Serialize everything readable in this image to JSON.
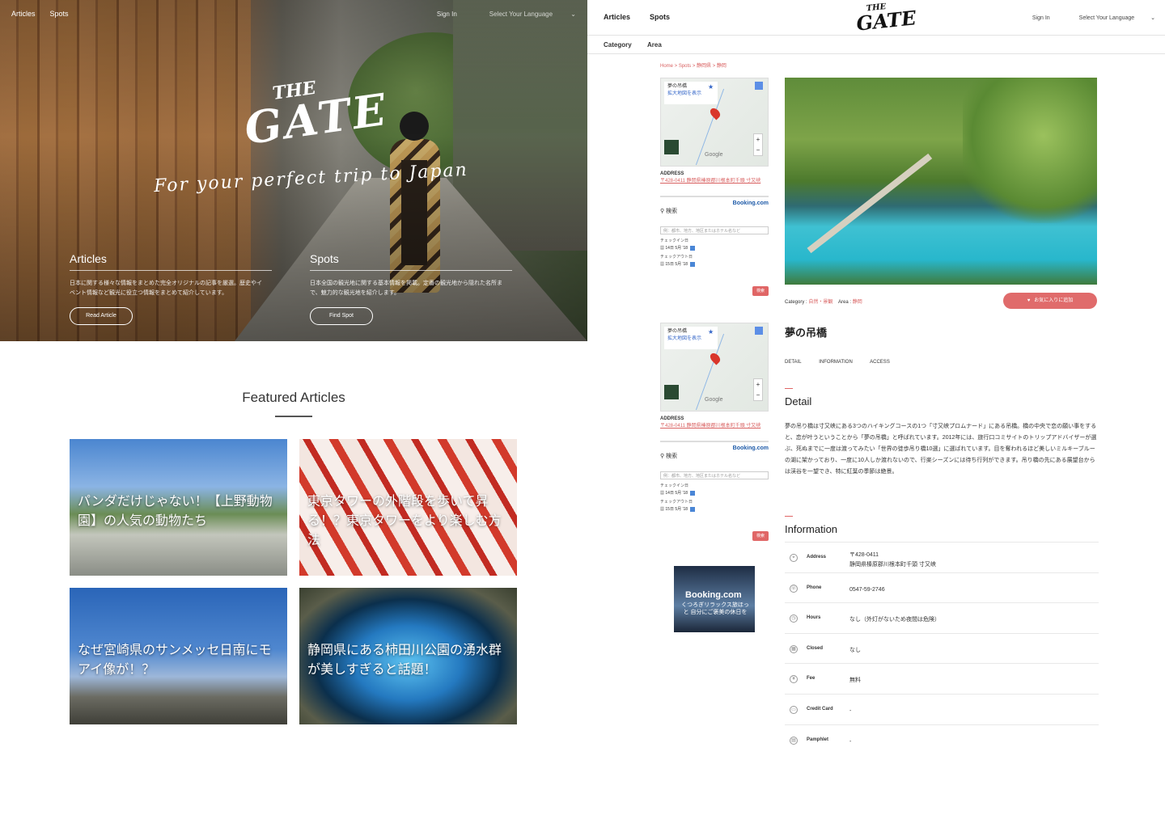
{
  "home": {
    "nav": {
      "articles": "Articles",
      "spots": "Spots",
      "sign_in": "Sign In",
      "language": "Select Your Language"
    },
    "logo": {
      "the": "THE",
      "gate": "GATE"
    },
    "tagline": "For your perfect trip to Japan",
    "articles_col": {
      "title": "Articles",
      "text": "日本に関する様々な情報をまとめた完全オリジナルの記事を厳選。歴史やイベント情報など観光に役立つ情報をまとめて紹介しています。",
      "button": "Read Article"
    },
    "spots_col": {
      "title": "Spots",
      "text": "日本全国の観光地に関する基本情報を掲載。定番の観光地から隠れた名所まで、魅力的な観光地を紹介します。",
      "button": "Find Spot"
    },
    "featured_title": "Featured Articles",
    "cards": [
      {
        "title": "パンダだけじゃない！【上野動物園】の人気の動物たち"
      },
      {
        "title": "東京タワーの外階段を歩いて昇る！？東京タワーをより楽しむ方法"
      },
      {
        "title": "なぜ宮崎県のサンメッセ日南にモアイ像が！？"
      },
      {
        "title": "静岡県にある柿田川公園の湧水群が美しすぎると話題！"
      }
    ]
  },
  "detail": {
    "nav": {
      "articles": "Articles",
      "spots": "Spots",
      "sign_in": "Sign In",
      "language": "Select Your Language"
    },
    "logo": {
      "the": "THE",
      "gate": "GATE"
    },
    "subnav": {
      "category": "Category",
      "area": "Area"
    },
    "breadcrumb": "Home > Spots > 静岡県 > 静岡",
    "map": {
      "name": "夢の吊橋",
      "link": "拡大地図を表示",
      "google": "Google",
      "address_label": "ADDRESS",
      "address_value": "〒428-0411 静岡県榛原郡川根本町千頭 寸又峡"
    },
    "booking": {
      "search": "検索",
      "brand": "Booking.com",
      "placeholder": "例：都市、地方、地区またはホテル名など",
      "checkin": "チェックイン日",
      "checkin_date": "14日 5月 '18",
      "checkout": "チェックアウト日",
      "checkout_date": "15日 5月 '18",
      "go": "検索"
    },
    "ad": {
      "brand": "Booking.com",
      "text": "くつろぎリラックス旅ほっと 自分にご褒美の休日を"
    },
    "category_label": "Category : ",
    "category_value": "自然・景観",
    "area_label": "Area : ",
    "area_value": "静岡",
    "fav_button": "お気に入りに追加",
    "spot_name": "夢の吊橋",
    "tabs": [
      "DETAIL",
      "INFORMATION",
      "ACCESS"
    ],
    "detail_heading": "Detail",
    "detail_text": "夢の吊り橋は寸又峡にある3つのハイキングコースの1つ「寸又峡プロムナード」にある吊橋。橋の中央で恋の願い事をすると、恋が叶うということから「夢の吊橋」と呼ばれています。2012年には、旅行口コミサイトのトリップアドバイザーが選ぶ、死ぬまでに一度は渡ってみたい「世界の徒歩吊り橋10選」に選ばれています。目を奪われるほど美しいミルキーブルーの湖に架かっており、一度に10人しか渡れないので、行楽シーズンには待ち行列ができます。吊り橋の先にある展望台からは渓谷を一望でき、特に紅葉の季節は絶景。",
    "info_heading": "Information",
    "info": [
      {
        "icon": "pin-icon",
        "label": "Address",
        "value": "〒428-0411",
        "value2": "静岡県榛原郡川根本町千頭 寸又峡"
      },
      {
        "icon": "phone-icon",
        "label": "Phone",
        "value": "0547-59-2746",
        "value2": ""
      },
      {
        "icon": "clock-icon",
        "label": "Hours",
        "value": "なし（外灯がないため夜間は危険）",
        "value2": ""
      },
      {
        "icon": "calendar-icon",
        "label": "Closed",
        "value": "なし",
        "value2": ""
      },
      {
        "icon": "yen-icon",
        "label": "Fee",
        "value": "無料",
        "value2": ""
      },
      {
        "icon": "credit-card-icon",
        "label": "Credit Card",
        "value": "-",
        "value2": ""
      },
      {
        "icon": "pamphlet-icon",
        "label": "Pamphlet",
        "value": "-",
        "value2": ""
      }
    ]
  }
}
